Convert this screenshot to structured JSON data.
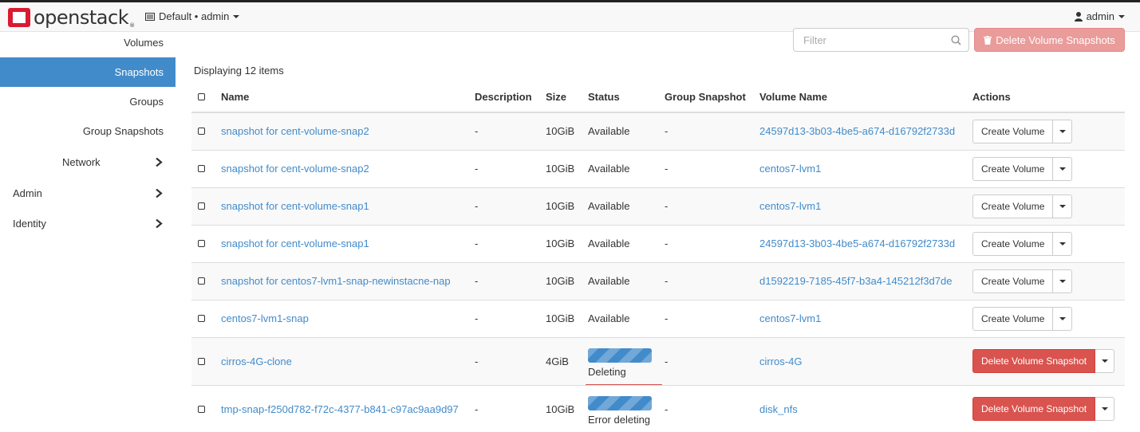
{
  "header": {
    "brand": "openstack",
    "brand_tm": "®",
    "project_label": "Default • admin",
    "user_label": "admin"
  },
  "sidebar": {
    "items": [
      {
        "label": "Volumes"
      },
      {
        "label": "Snapshots"
      },
      {
        "label": "Groups"
      },
      {
        "label": "Group Snapshots"
      },
      {
        "label": "Network"
      },
      {
        "label": "Admin"
      },
      {
        "label": "Identity"
      }
    ]
  },
  "toolbar": {
    "filter_placeholder": "Filter",
    "delete_button": "Delete Volume Snapshots"
  },
  "table": {
    "count_text": "Displaying 12 items",
    "headers": {
      "name": "Name",
      "description": "Description",
      "size": "Size",
      "status": "Status",
      "group_snapshot": "Group Snapshot",
      "volume_name": "Volume Name",
      "actions": "Actions"
    },
    "rows": [
      {
        "name": "snapshot for cent-volume-snap2",
        "description": "-",
        "size": "10GiB",
        "status": "Available",
        "group_snapshot": "-",
        "volume": "24597d13-3b03-4be5-a674-d16792f2733d",
        "action": "Create Volume"
      },
      {
        "name": "snapshot for cent-volume-snap2",
        "description": "-",
        "size": "10GiB",
        "status": "Available",
        "group_snapshot": "-",
        "volume": "centos7-lvm1",
        "action": "Create Volume"
      },
      {
        "name": "snapshot for cent-volume-snap1",
        "description": "-",
        "size": "10GiB",
        "status": "Available",
        "group_snapshot": "-",
        "volume": "centos7-lvm1",
        "action": "Create Volume"
      },
      {
        "name": "snapshot for cent-volume-snap1",
        "description": "-",
        "size": "10GiB",
        "status": "Available",
        "group_snapshot": "-",
        "volume": "24597d13-3b03-4be5-a674-d16792f2733d",
        "action": "Create Volume"
      },
      {
        "name": "snapshot for centos7-lvm1-snap-newinstacne-nap",
        "description": "-",
        "size": "10GiB",
        "status": "Available",
        "group_snapshot": "-",
        "volume": "d1592219-7185-45f7-b3a4-145212f3d7de",
        "action": "Create Volume"
      },
      {
        "name": "centos7-lvm1-snap",
        "description": "-",
        "size": "10GiB",
        "status": "Available",
        "group_snapshot": "-",
        "volume": "centos7-lvm1",
        "action": "Create Volume"
      },
      {
        "name": "cirros-4G-clone",
        "description": "-",
        "size": "4GiB",
        "status": "Deleting",
        "group_snapshot": "-",
        "volume": "cirros-4G",
        "action": "Delete Volume Snapshot"
      },
      {
        "name": "tmp-snap-f250d782-f72c-4377-b841-c97ac9aa9d97",
        "description": "-",
        "size": "10GiB",
        "status": "Error deleting",
        "group_snapshot": "-",
        "volume": "disk_nfs",
        "action": "Delete Volume Snapshot"
      }
    ]
  },
  "colors": {
    "accent": "#428bca",
    "danger": "#d9534f",
    "danger_light": "#e99c9a"
  }
}
